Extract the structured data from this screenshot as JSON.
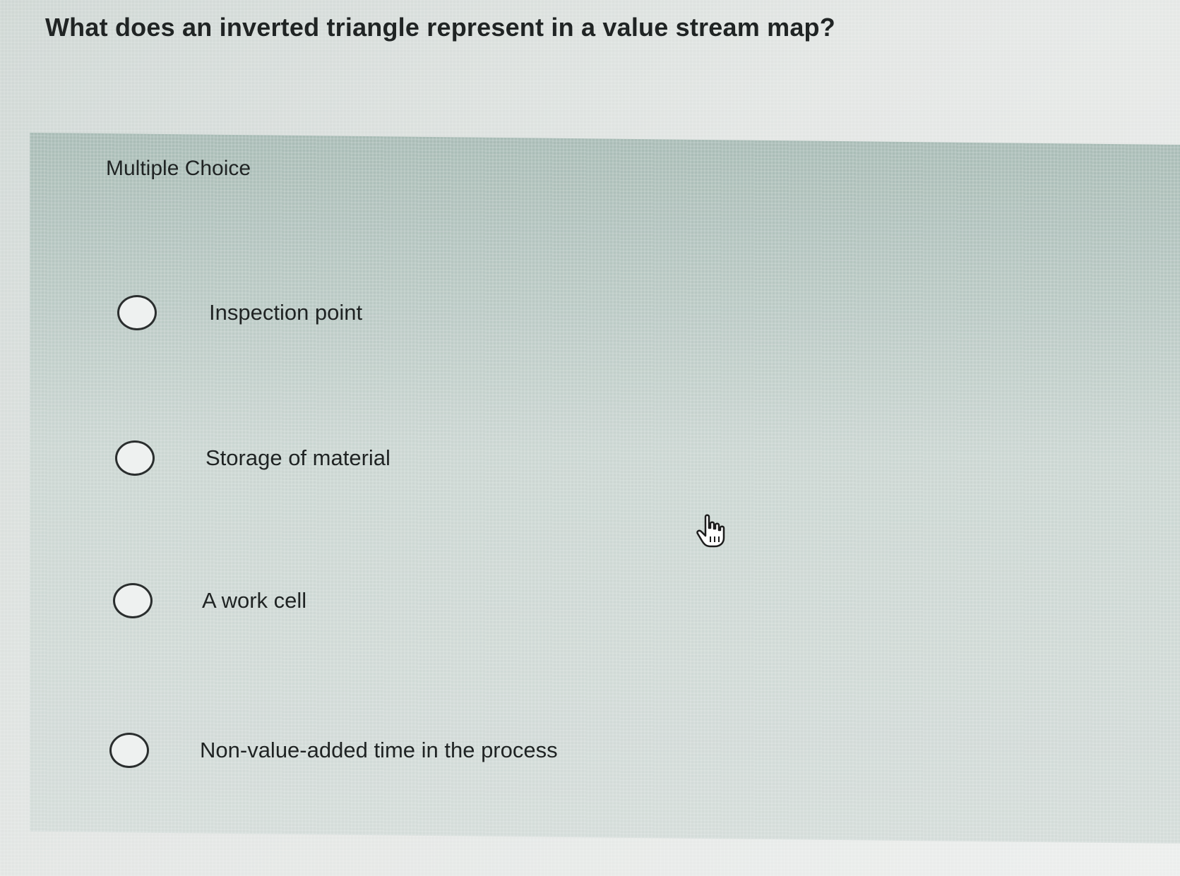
{
  "question": {
    "text": "What does an inverted triangle represent in a value stream map?"
  },
  "panel": {
    "label": "Multiple Choice"
  },
  "options": [
    {
      "label": "Inspection point",
      "selected": false
    },
    {
      "label": "Storage of material",
      "selected": false
    },
    {
      "label": "A work cell",
      "selected": false
    },
    {
      "label": "Non-value-added time in the process",
      "selected": false
    }
  ],
  "cursor": {
    "icon": "hand-pointer-icon"
  }
}
